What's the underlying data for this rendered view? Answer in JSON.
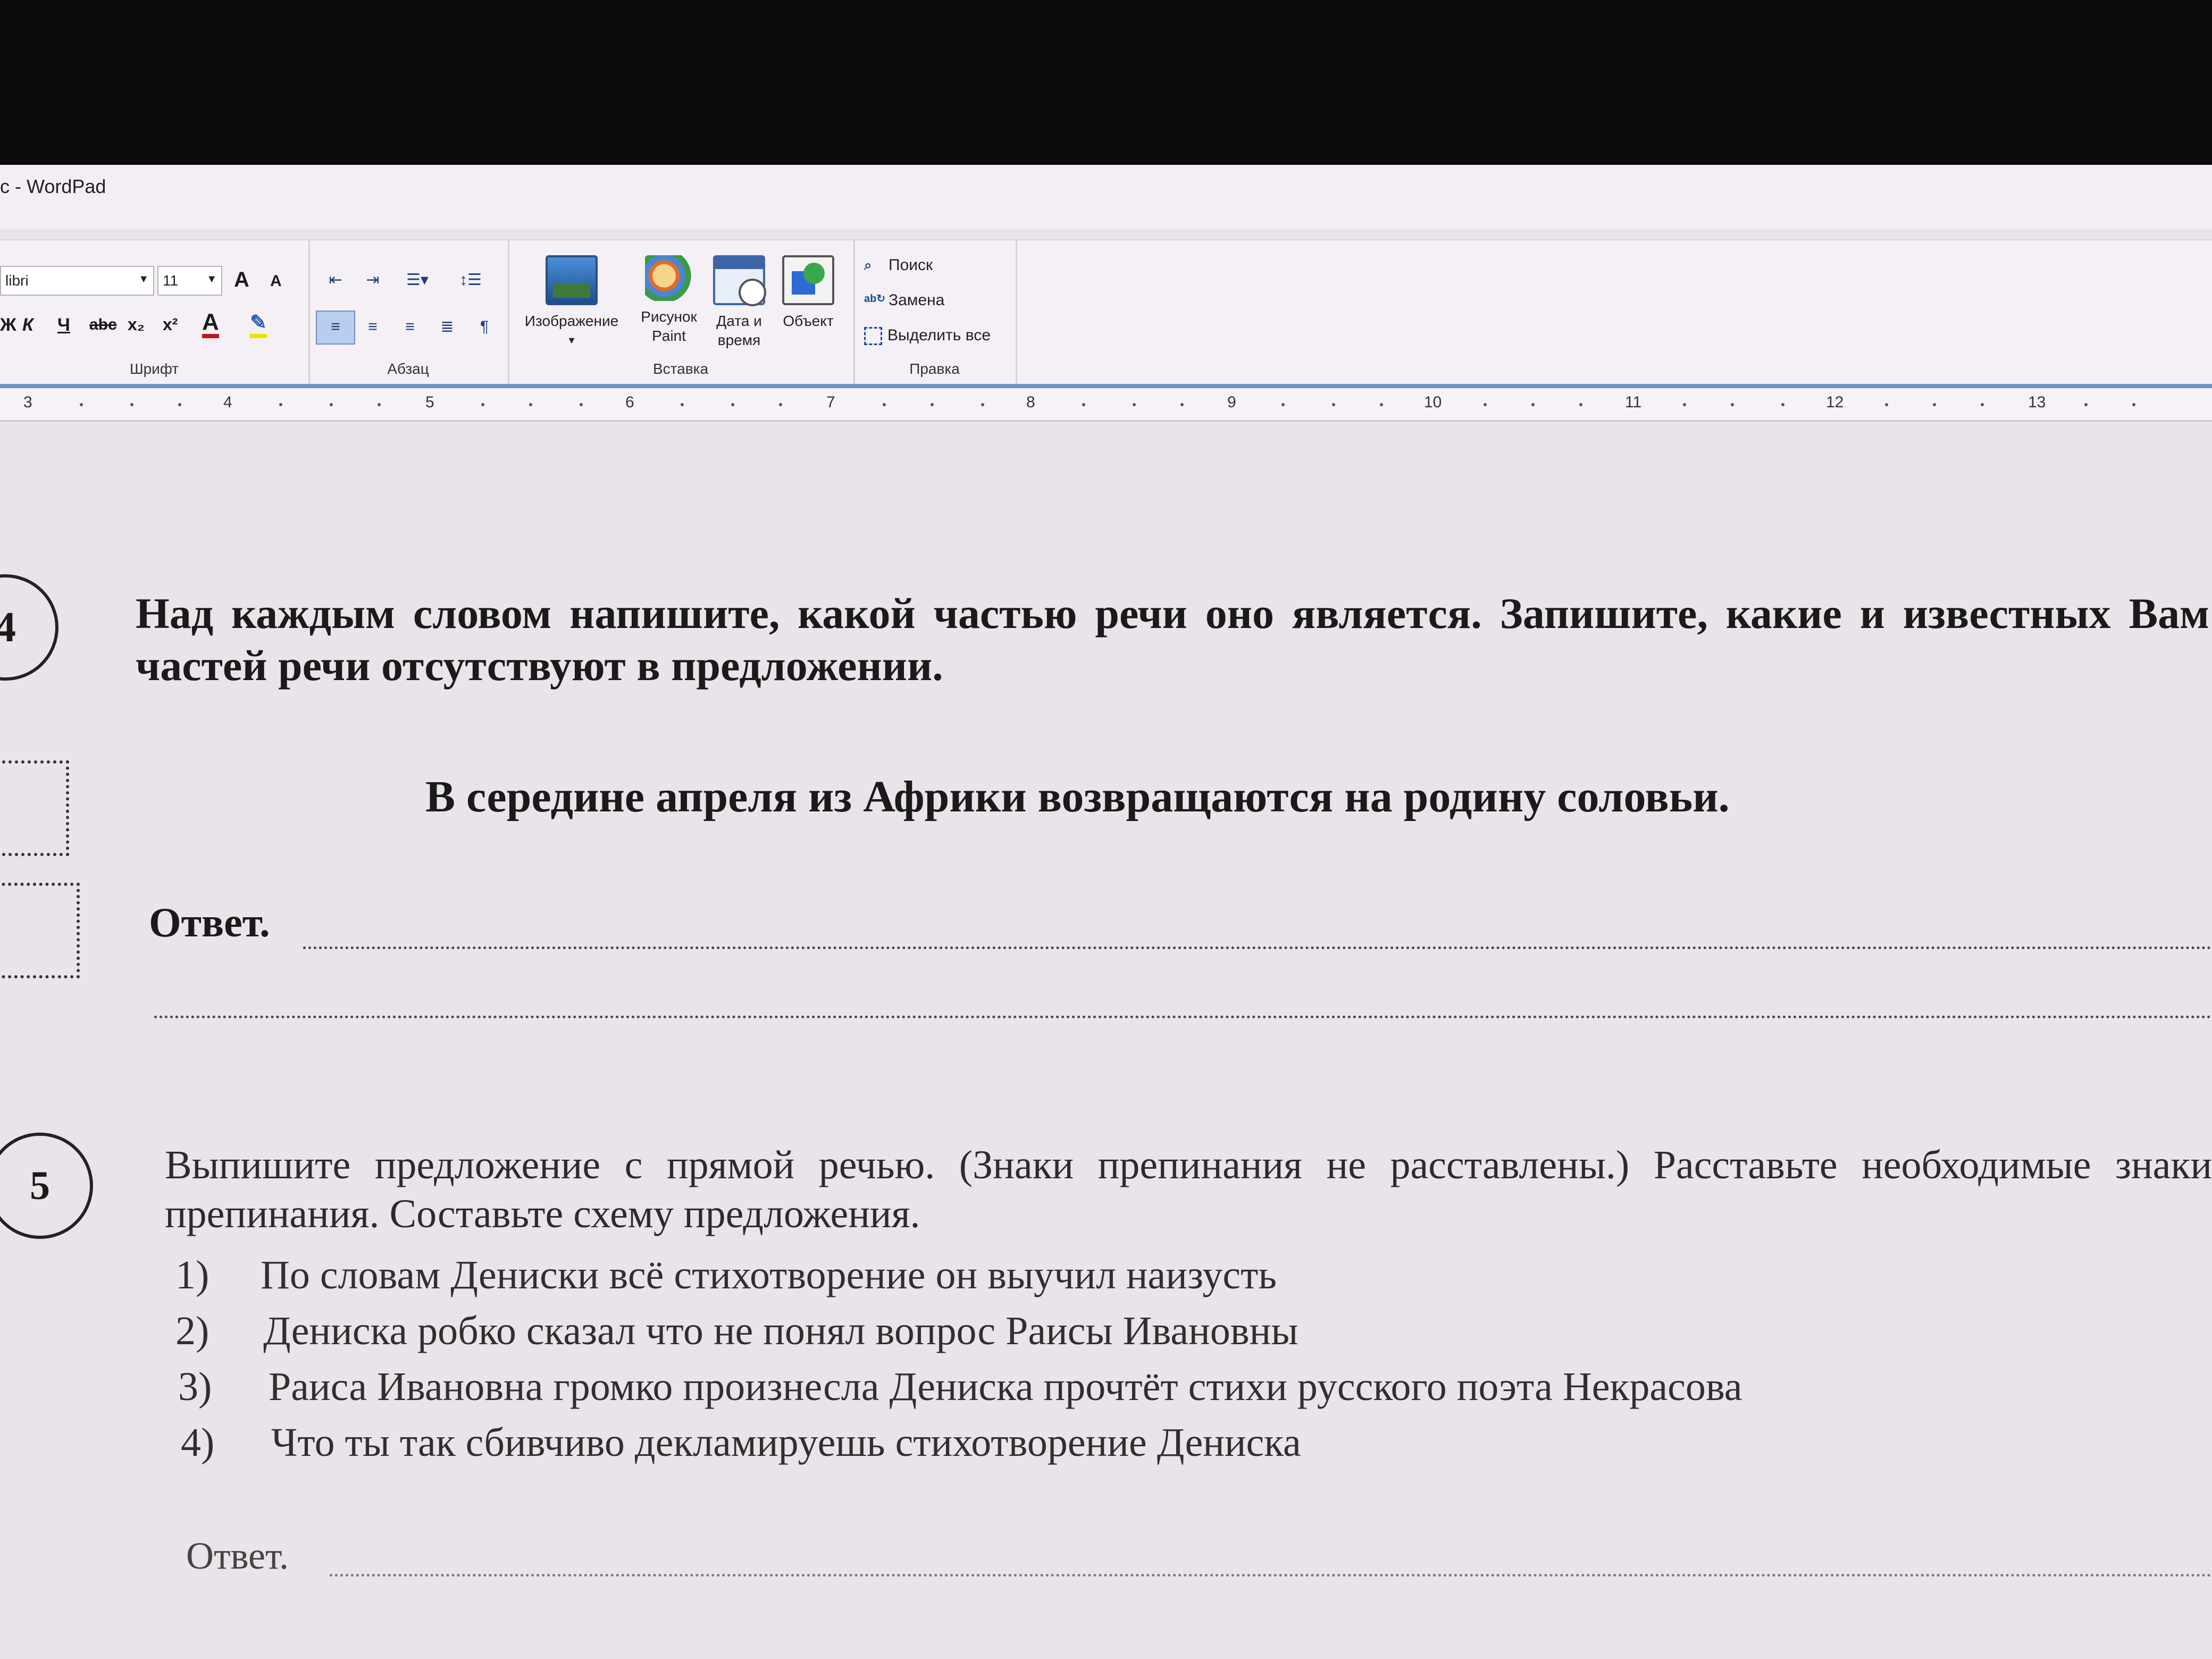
{
  "window": {
    "title": "c - WordPad"
  },
  "ribbon": {
    "font_group": {
      "label": "Шрифт",
      "font_name": "libri",
      "font_size": "11",
      "grow_font": "A",
      "shrink_font": "A",
      "bold": "Ж",
      "italic": "К",
      "underline": "Ч",
      "strikethrough": "abc",
      "subscript": "x₂",
      "superscript": "x²",
      "text_color": "A"
    },
    "paragraph_group": {
      "label": "Абзац"
    },
    "insert_group": {
      "label": "Вставка",
      "image": "Изображение",
      "paint_1": "Рисунок",
      "paint_2": "Paint",
      "datetime_1": "Дата и",
      "datetime_2": "время",
      "object": "Объект"
    },
    "edit_group": {
      "label": "Правка",
      "find": "Поиск",
      "replace": "Замена",
      "select_all": "Выделить все"
    }
  },
  "ruler": {
    "marks": [
      "3",
      "4",
      "5",
      "6",
      "7",
      "8",
      "9",
      "10",
      "11",
      "12",
      "13"
    ]
  },
  "document": {
    "task4": {
      "number": "4",
      "text": "Над каждым словом напишите, какой частью речи оно является. Запишите, какие и известных Вам частей речи отсутствуют в предложении.",
      "sentence": "В середине апреля из Африки возвращаются на родину соловьи.",
      "answer_label": "Ответ."
    },
    "task5": {
      "number": "5",
      "text": "Выпишите предложение с прямой речью. (Знаки препинания не расставлены.) Расставьте необходимые знаки препинания. Составьте схему предложения.",
      "options": [
        {
          "num": "1)",
          "text": "По словам Дениски всё стихотворение он выучил наизусть"
        },
        {
          "num": "2)",
          "text": "Дениска робко сказал что не понял вопрос Раисы Ивановны"
        },
        {
          "num": "3)",
          "text": "Раиса Ивановна громко произнесла Дениска прочтёт стихи русского поэта Некрасова"
        },
        {
          "num": "4)",
          "text": "Что ты так сбивчиво декламируешь стихотворение Дениска"
        }
      ],
      "answer_label": "Ответ."
    }
  }
}
